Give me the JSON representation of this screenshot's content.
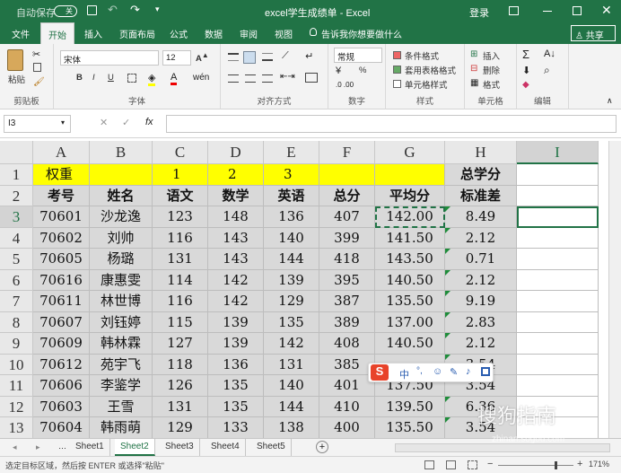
{
  "titlebar": {
    "autosave_label": "自动保存",
    "autosave_state": "关",
    "title": "excel学生成绩单  -  Excel",
    "login": "登录"
  },
  "ribbon_tabs": [
    "文件",
    "开始",
    "插入",
    "页面布局",
    "公式",
    "数据",
    "审阅",
    "视图",
    "告诉我你想要做什么",
    "共享"
  ],
  "ribbon": {
    "clipboard": {
      "paste": "粘贴",
      "label": "剪贴板"
    },
    "font": {
      "name": "宋体",
      "size": "12",
      "bold": "B",
      "italic": "I",
      "underline": "U",
      "label": "字体"
    },
    "align": {
      "label": "对齐方式"
    },
    "number": {
      "format": "常规",
      "percent": "%",
      "label": "数字"
    },
    "styles": {
      "cond": "条件格式",
      "table": "套用表格格式",
      "cell": "单元格样式",
      "label": "样式"
    },
    "cells": {
      "insert": "插入",
      "delete": "删除",
      "format": "格式",
      "label": "单元格"
    },
    "edit": {
      "label": "编辑"
    }
  },
  "formula_bar": {
    "namebox": "I3",
    "fx": "fx",
    "formula": ""
  },
  "grid": {
    "columns": [
      "A",
      "B",
      "C",
      "D",
      "E",
      "F",
      "G",
      "H",
      "I"
    ],
    "selected_column": "I",
    "rows": [
      "1",
      "2",
      "3",
      "4",
      "5",
      "6",
      "7",
      "8",
      "9",
      "10",
      "11",
      "12",
      "13"
    ],
    "selected_row": "3",
    "colors": {
      "weight_row": "#ffff00",
      "header_gray": "#d9d9d9",
      "accent": "#217346"
    },
    "cells": [
      [
        "权重",
        "",
        "1",
        "2",
        "3",
        "",
        "",
        "总学分",
        ""
      ],
      [
        "考号",
        "姓名",
        "语文",
        "数学",
        "英语",
        "总分",
        "平均分",
        "标准差",
        ""
      ],
      [
        "70601",
        "沙龙逸",
        "123",
        "148",
        "136",
        "407",
        "142.00",
        "8.49",
        ""
      ],
      [
        "70602",
        "刘帅",
        "116",
        "143",
        "140",
        "399",
        "141.50",
        "2.12",
        ""
      ],
      [
        "70605",
        "杨璐",
        "131",
        "143",
        "144",
        "418",
        "143.50",
        "0.71",
        ""
      ],
      [
        "70616",
        "康惠雯",
        "114",
        "142",
        "139",
        "395",
        "140.50",
        "2.12",
        ""
      ],
      [
        "70611",
        "林世博",
        "116",
        "142",
        "129",
        "387",
        "135.50",
        "9.19",
        ""
      ],
      [
        "70607",
        "刘钰婷",
        "115",
        "139",
        "135",
        "389",
        "137.00",
        "2.83",
        ""
      ],
      [
        "70609",
        "韩林霖",
        "127",
        "139",
        "142",
        "408",
        "140.50",
        "2.12",
        ""
      ],
      [
        "70612",
        "苑宇飞",
        "118",
        "136",
        "131",
        "385",
        "",
        "3.54",
        ""
      ],
      [
        "70606",
        "李鉴学",
        "126",
        "135",
        "140",
        "401",
        "137.50",
        "3.54",
        ""
      ],
      [
        "70603",
        "王雪",
        "131",
        "135",
        "144",
        "410",
        "139.50",
        "6.36",
        ""
      ],
      [
        "70604",
        "韩雨萌",
        "129",
        "133",
        "138",
        "400",
        "135.50",
        "3.54",
        ""
      ]
    ]
  },
  "sheets": [
    "Sheet1",
    "Sheet2",
    "Sheet3",
    "Sheet4",
    "Sheet5"
  ],
  "active_sheet": "Sheet2",
  "status": {
    "message": "选定目标区域，然后按 ENTER 或选择\"粘贴\"",
    "zoom": "171%"
  },
  "ime": {
    "mode": "中"
  },
  "watermark": {
    "main": "搜狗指南",
    "sub": "zhinan.sogou.com"
  }
}
